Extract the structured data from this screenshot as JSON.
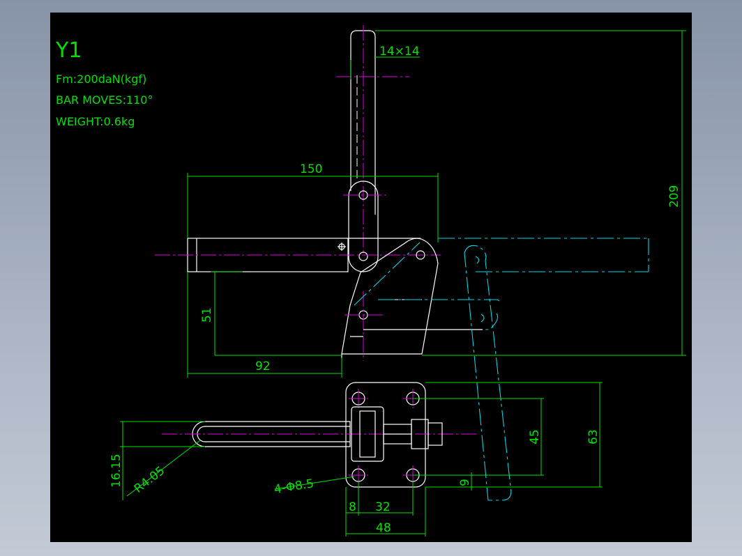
{
  "drawing": {
    "title": "Y1",
    "notes": [
      "Fm:200daN(kgf)",
      "BAR MOVES:110°",
      "WEIGHT:0.6kg"
    ],
    "colors": {
      "background": "#000000",
      "outline": "#ffffff",
      "dimension": "#00e000",
      "centerline": "#e000e0",
      "alternate_position": "#00d8e8"
    }
  },
  "dimensions": {
    "bar_section": "14×14",
    "overall_length": "150",
    "overall_height": "209",
    "handle_height": "51",
    "base_length": "92",
    "radius": "R4.05",
    "bar_offset": "16.15",
    "holes": "4-Φ8.5",
    "hole_spacing_v": "45",
    "base_height": "63",
    "hole_edge": "9",
    "hole_margin": "8",
    "hole_spacing_h": "32",
    "base_width": "48"
  }
}
